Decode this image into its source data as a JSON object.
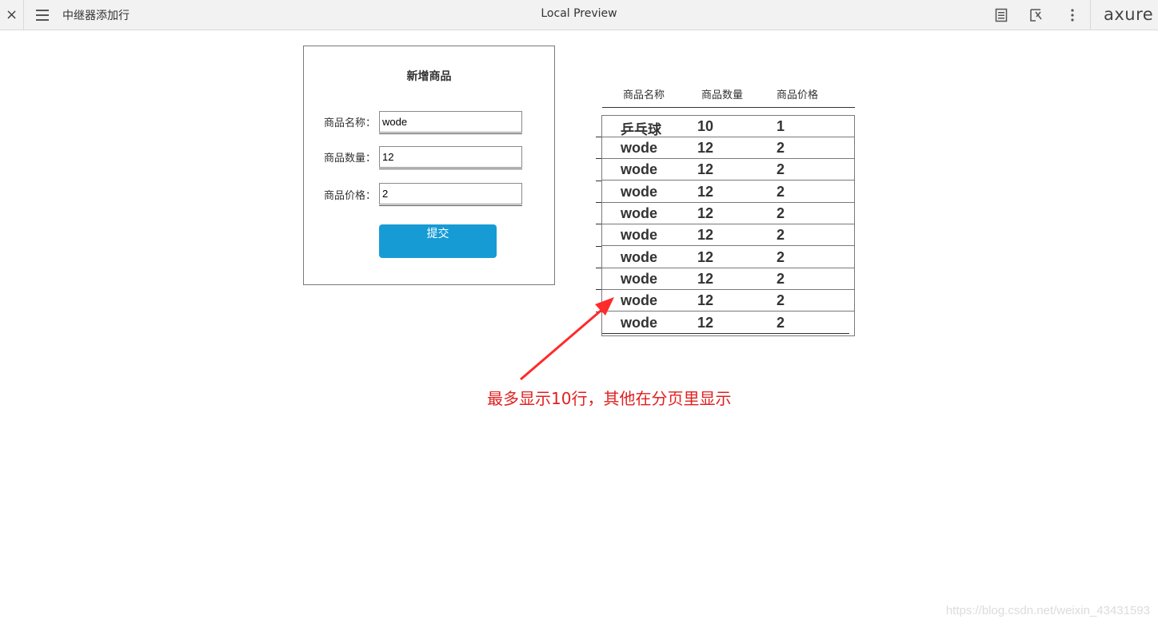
{
  "toolbar": {
    "close_glyph": "×",
    "page_name": "中继器添加行",
    "title": "Local Preview",
    "logo": "axure"
  },
  "form": {
    "title": "新增商品",
    "name_label": "商品名称：",
    "name_value": "wode",
    "qty_label": "商品数量：",
    "qty_value": "12",
    "price_label": "商品价格：",
    "price_value": "2",
    "submit_label": "提交"
  },
  "table": {
    "headers": [
      "商品名称",
      "商品数量",
      "商品价格"
    ],
    "rows": [
      [
        "乒乓球",
        "10",
        "1"
      ],
      [
        "wode",
        "12",
        "2"
      ],
      [
        "wode",
        "12",
        "2"
      ],
      [
        "wode",
        "12",
        "2"
      ],
      [
        "wode",
        "12",
        "2"
      ],
      [
        "wode",
        "12",
        "2"
      ],
      [
        "wode",
        "12",
        "2"
      ],
      [
        "wode",
        "12",
        "2"
      ],
      [
        "wode",
        "12",
        "2"
      ],
      [
        "wode",
        "12",
        "2"
      ]
    ]
  },
  "annotation": {
    "text": "最多显示10行，其他在分页里显示",
    "color": "#e02020"
  },
  "watermark": "https://blog.csdn.net/weixin_43431593",
  "colors": {
    "button": "#169bd5",
    "toolbar_bg": "#f2f2f2"
  }
}
